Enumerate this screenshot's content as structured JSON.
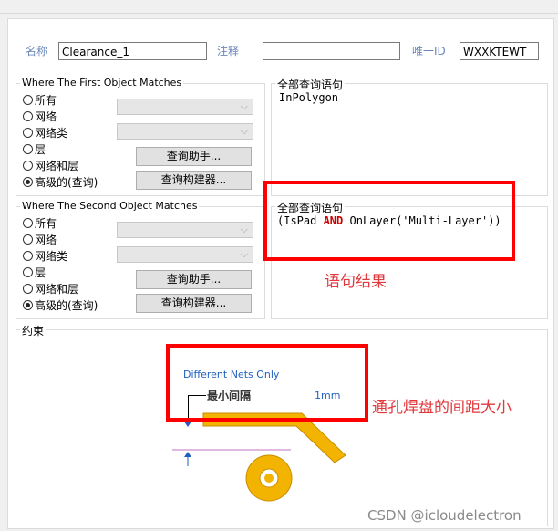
{
  "header": {
    "name_label": "名称",
    "name_value": "Clearance_1",
    "comment_label": "注释",
    "comment_value": "",
    "uid_label": "唯一ID",
    "uid_value": "WXXKTEWT"
  },
  "first_match": {
    "title": "Where The First Object Matches",
    "options": [
      "所有",
      "网络",
      "网络类",
      "层",
      "网络和层",
      "高级的(查询)"
    ],
    "selected": "高级的(查询)",
    "helper_button": "查询助手...",
    "builder_button": "查询构建器..."
  },
  "second_match": {
    "title": "Where The Second Object Matches",
    "options": [
      "所有",
      "网络",
      "网络类",
      "层",
      "网络和层",
      "高级的(查询)"
    ],
    "selected": "高级的(查询)",
    "helper_button": "查询助手...",
    "builder_button": "查询构建器..."
  },
  "query1": {
    "title": "全部查询语句",
    "text": "InPolygon"
  },
  "query2": {
    "title": "全部查询语句",
    "text_part1": "(IsPad ",
    "keyword": "AND",
    "text_part2": " OnLayer('Multi-Layer'))",
    "keyword_color": "#cc0000"
  },
  "constraints": {
    "title": "约束",
    "net_scope": "Different Nets Only",
    "min_clearance_label": "最小间隔",
    "min_clearance_value": "1mm"
  },
  "annotations": {
    "query_result": "语句结果",
    "via_pad_clearance": "通孔焊盘的间距大小"
  },
  "watermark": "CSDN @icloudelectron",
  "colors": {
    "highlight_box": "#ff0000",
    "annotation_text": "#e0393e",
    "track_fill": "#f2b400",
    "net_scope_text": "#1f5fbf"
  }
}
